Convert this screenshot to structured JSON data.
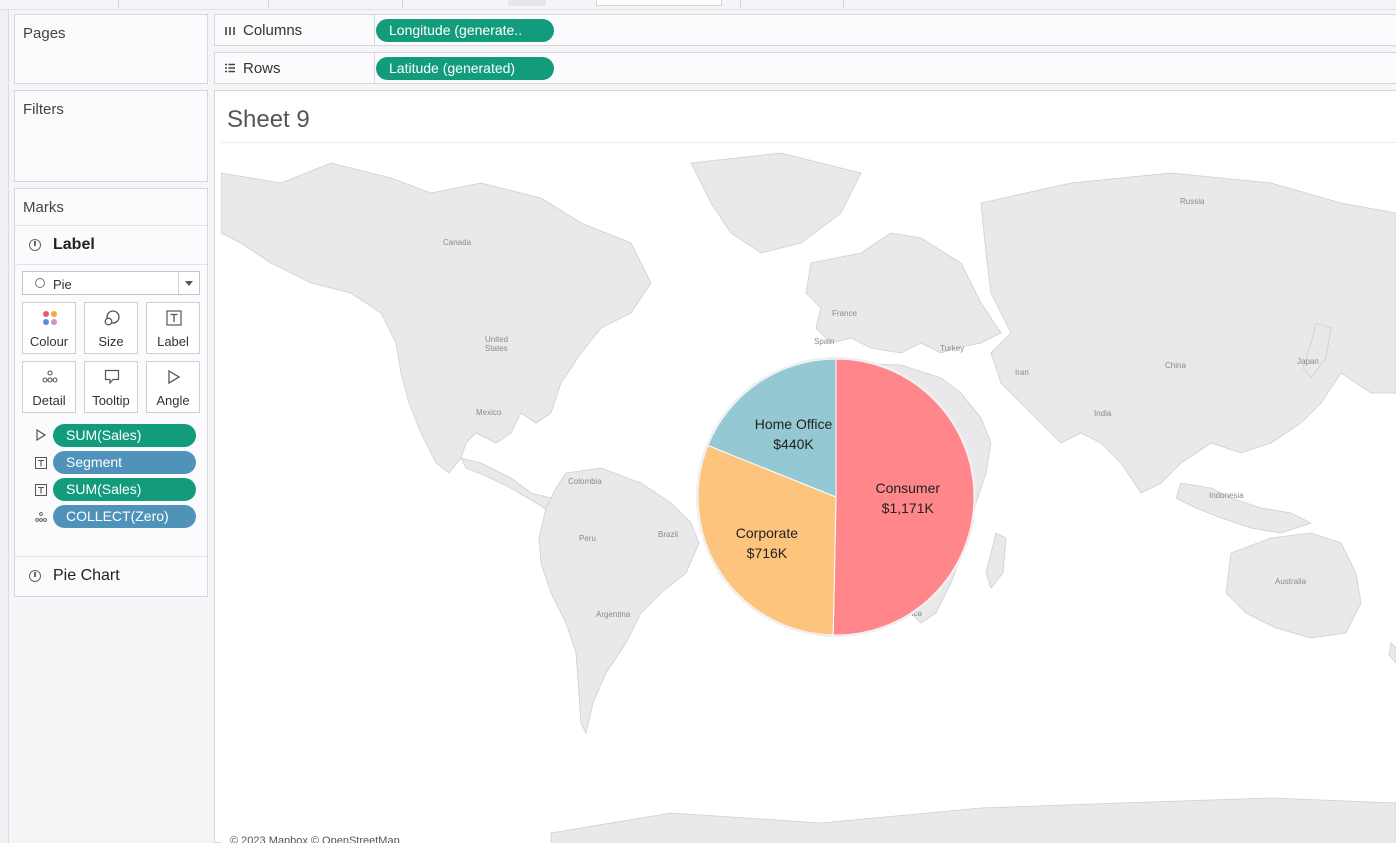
{
  "panels": {
    "pages_title": "Pages",
    "filters_title": "Filters",
    "marks_title": "Marks"
  },
  "marks": {
    "active_card": "Label",
    "mark_type": "Pie",
    "buttons": {
      "colour": "Colour",
      "size": "Size",
      "label": "Label",
      "detail": "Detail",
      "tooltip": "Tooltip",
      "angle": "Angle"
    },
    "fields": [
      {
        "name": "SUM(Sales)",
        "role": "angle-icon",
        "color": "#139c7c"
      },
      {
        "name": "Segment",
        "role": "text-icon",
        "color": "#4f93ba"
      },
      {
        "name": "SUM(Sales)",
        "role": "text-icon",
        "color": "#139c7c"
      },
      {
        "name": "COLLECT(Zero)",
        "role": "detail-icon",
        "color": "#4f93ba"
      }
    ],
    "second_card": "Pie Chart"
  },
  "shelves": {
    "columns_label": "Columns",
    "columns_pill": "Longitude (generate..",
    "rows_label": "Rows",
    "rows_pill": "Latitude (generated)"
  },
  "sheet": {
    "title": "Sheet 9",
    "attribution": "© 2023 Mapbox © OpenStreetMap"
  },
  "map": {
    "labels": {
      "canada": "Canada",
      "us": "United States",
      "mexico": "Mexico",
      "colombia": "Colombia",
      "peru": "Peru",
      "brazil": "Brazil",
      "argentina": "Argentina",
      "russia": "Russia",
      "france": "France",
      "spain": "Spain",
      "turkey": "Turkey",
      "iran": "Iran",
      "india": "India",
      "china": "China",
      "japan": "Japan",
      "indonesia": "Indonesia",
      "australia": "Australia",
      "south_africa": "rica"
    }
  },
  "chart_data": {
    "type": "pie",
    "title": "",
    "slices": [
      {
        "label": "Consumer",
        "value": 1171,
        "display": "$1,171K",
        "color": "#ff878b"
      },
      {
        "label": "Corporate",
        "value": 716,
        "display": "$716K",
        "color": "#fdc47d"
      },
      {
        "label": "Home Office",
        "value": 440,
        "display": "$440K",
        "color": "#94c8d2"
      }
    ],
    "units": "$K"
  }
}
